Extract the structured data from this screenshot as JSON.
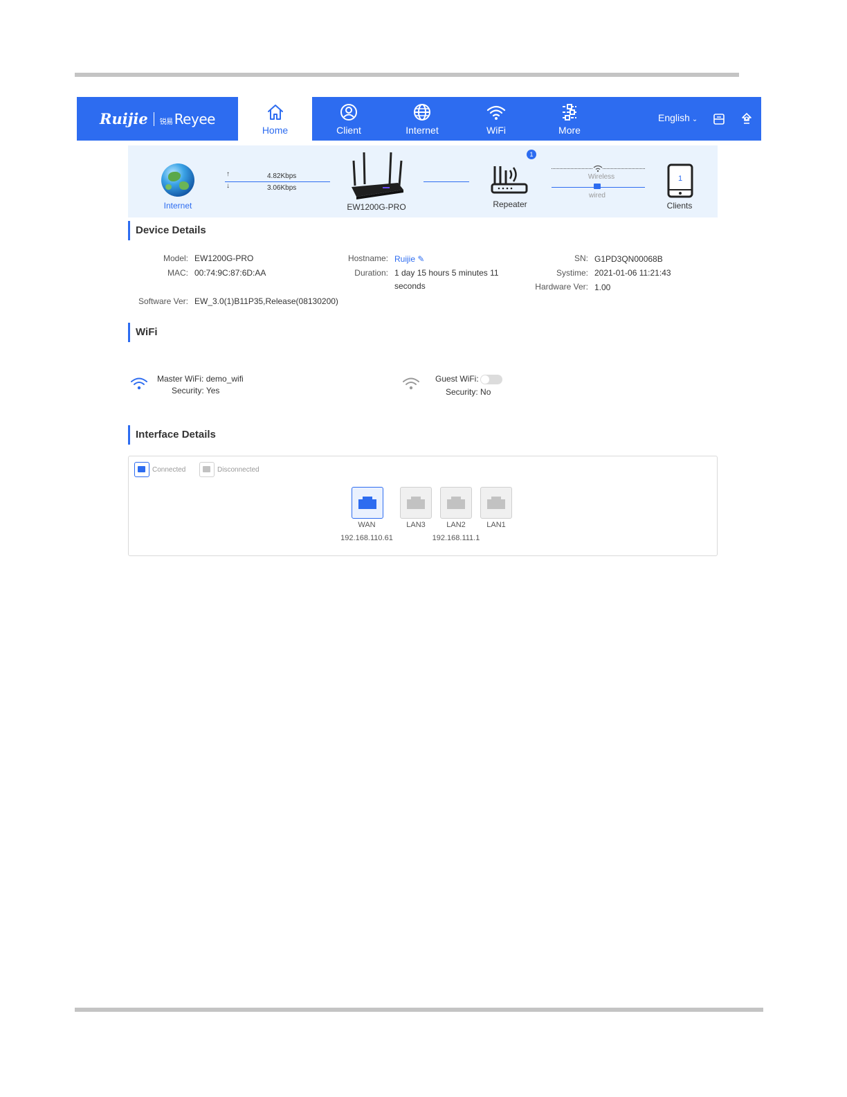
{
  "header": {
    "logo_primary": "Ruijie",
    "logo_secondary": "Reyee",
    "logo_secondary_prefix": "锐易",
    "nav": [
      {
        "label": "Home",
        "icon": "home-icon",
        "active": true
      },
      {
        "label": "Client",
        "icon": "user-circle-icon"
      },
      {
        "label": "Internet",
        "icon": "globe-icon"
      },
      {
        "label": "WiFi",
        "icon": "wifi-icon"
      },
      {
        "label": "More",
        "icon": "sliders-icon"
      }
    ],
    "language": "English",
    "accent_color": "#2d6cf0"
  },
  "topology": {
    "internet_label": "Internet",
    "upload_speed": "4.82Kbps",
    "download_speed": "3.06Kbps",
    "router_label": "EW1200G-PRO",
    "repeater_label": "Repeater",
    "repeater_badge": "1",
    "wireless_label": "Wireless",
    "wired_label": "wired",
    "clients_count": "1",
    "clients_label": "Clients"
  },
  "device_details": {
    "title": "Device Details",
    "model_label": "Model:",
    "model": "EW1200G-PRO",
    "mac_label": "MAC:",
    "mac": "00:74:9C:87:6D:AA",
    "software_label": "Software Ver:",
    "software": "EW_3.0(1)B11P35,Release(08130200)",
    "hostname_label": "Hostname:",
    "hostname": "Ruijie",
    "duration_label": "Duration:",
    "duration_line1": "1 day 15 hours 5 minutes 11",
    "duration_line2": "seconds",
    "sn_label": "SN:",
    "sn": "G1PD3QN00068B",
    "systime_label": "Systime:",
    "systime": "2021-01-06 11:21:43",
    "hardware_label": "Hardware Ver:",
    "hardware": "1.00"
  },
  "wifi": {
    "title": "WiFi",
    "master_label": "Master WiFi:",
    "master_ssid": "demo_wifi",
    "master_security_label": "Security:",
    "master_security": "Yes",
    "guest_label": "Guest WiFi:",
    "guest_enabled": false,
    "guest_security_label": "Security:",
    "guest_security": "No"
  },
  "interfaces": {
    "title": "Interface Details",
    "legend_connected": "Connected",
    "legend_disconnected": "Disconnected",
    "ports": [
      {
        "name": "WAN",
        "connected": true
      },
      {
        "name": "LAN3",
        "connected": false
      },
      {
        "name": "LAN2",
        "connected": false
      },
      {
        "name": "LAN1",
        "connected": false
      }
    ],
    "wan_ip": "192.168.110.61",
    "lan_ip": "192.168.111.1"
  }
}
